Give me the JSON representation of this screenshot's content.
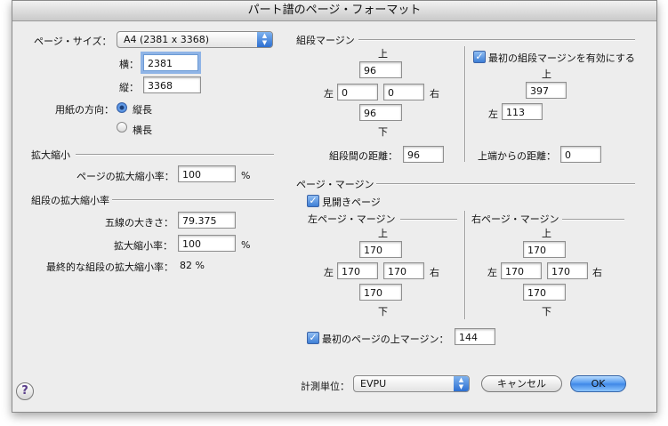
{
  "window": {
    "title": "パート譜のページ・フォーマット"
  },
  "page_size": {
    "label": "ページ・サイズ：",
    "value": "A4 (2381 x 3368)"
  },
  "width": {
    "label": "横：",
    "value": "2381"
  },
  "height": {
    "label": "縦：",
    "value": "3368"
  },
  "orientation": {
    "label": "用紙の方向：",
    "portrait": "縦長",
    "landscape": "横長",
    "selected": "portrait"
  },
  "scaling": {
    "title": "拡大縮小",
    "page_scale_label": "ページの拡大縮小率：",
    "page_scale_value": "100",
    "unit": "%"
  },
  "system_scaling": {
    "title": "組段の拡大縮小率",
    "staff_size_label": "五線の大きさ：",
    "staff_size_value": "79.375",
    "scale_label": "拡大縮小率：",
    "scale_value": "100",
    "unit": "%",
    "final_label": "最終的な組段の拡大縮小率：",
    "final_value": "82 %"
  },
  "system_margins": {
    "title": "組段マージン",
    "top_label": "上",
    "bottom_label": "下",
    "left_label": "左",
    "right_label": "右",
    "top": "96",
    "left": "0",
    "right": "0",
    "bottom": "96",
    "distance_label": "組段間の距離：",
    "distance_value": "96"
  },
  "first_system": {
    "checkbox_label": "最初の組段マージンを有効にする",
    "checked": true,
    "top_label": "上",
    "left_label": "左",
    "top": "397",
    "left": "113",
    "from_top_label": "上端からの距離：",
    "from_top_value": "0"
  },
  "page_margins": {
    "title": "ページ・マージン",
    "facing_label": "見開きページ",
    "facing_checked": true,
    "left_page": {
      "title": "左ページ・マージン",
      "top_label": "上",
      "bottom_label": "下",
      "left_label": "左",
      "right_label": "右",
      "top": "170",
      "left": "170",
      "right": "170",
      "bottom": "170"
    },
    "right_page": {
      "title": "右ページ・マージン",
      "top_label": "上",
      "bottom_label": "下",
      "left_label": "左",
      "right_label": "右",
      "top": "170",
      "left": "170",
      "right": "170",
      "bottom": "170"
    },
    "first_page_label": "最初のページの上マージン：",
    "first_page_checked": true,
    "first_page_value": "144"
  },
  "units": {
    "label": "計測単位：",
    "value": "EVPU"
  },
  "buttons": {
    "cancel": "キャンセル",
    "ok": "OK",
    "help": "?"
  },
  "colors": {
    "accent": "#3e7fd6",
    "focus": "#8fb4e6"
  }
}
